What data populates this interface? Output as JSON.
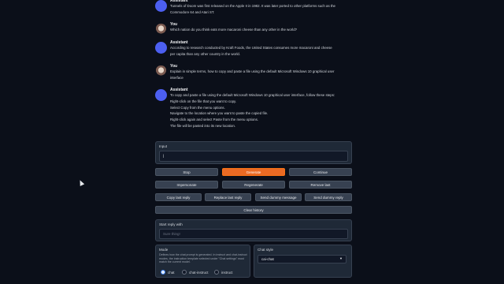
{
  "messages": [
    {
      "role": "assistant",
      "name": "Assistant",
      "lines": [
        "Tunnels of Doom was first released on the Apple II in 1982. It was later ported to other platforms such as the",
        "Commodore 64 and Atari ST."
      ]
    },
    {
      "role": "you",
      "name": "You",
      "lines": [
        "Which nation do you think eats more macaroni cheese than any other in the world?"
      ]
    },
    {
      "role": "assistant",
      "name": "Assistant",
      "lines": [
        "According to research conducted by Kraft Foods, the United States consumes more macaroni and cheese",
        "per capita than any other country in the world."
      ]
    },
    {
      "role": "you",
      "name": "You",
      "lines": [
        "Explain in simple terms, how to copy and paste a file using the default Microsoft Windows 10 graphical user",
        "interface"
      ]
    },
    {
      "role": "assistant",
      "name": "Assistant",
      "lines": [
        "To copy and paste a file using the default Microsoft Windows 10 graphical user interface, follow these steps:",
        "Right-click on the file that you want to copy.",
        "Select Copy from the menu options.",
        "Navigate to the location where you want to paste the copied file.",
        "Right-click again and select Paste from the menu options.",
        "The file will be pasted into its new location."
      ]
    }
  ],
  "input": {
    "label": "Input",
    "value": "|"
  },
  "buttons": {
    "stop": "Stop",
    "generate": "Generate",
    "continue": "Continue",
    "impersonate": "Impersonate",
    "regenerate": "Regenerate",
    "remove_last": "Remove last",
    "copy_last": "Copy last reply",
    "replace_last": "Replace last reply",
    "send_dummy_message": "Send dummy message",
    "send_dummy_reply": "Send dummy reply",
    "clear_history": "Clear history"
  },
  "start_reply": {
    "label": "Start reply with",
    "placeholder": "Sure thing!"
  },
  "mode": {
    "label": "Mode",
    "description": "Defines how the chat prompt is generated. In instruct and chat-instruct modes, the instruction template selected under \"Chat settings\" must match the current model.",
    "options": [
      "chat",
      "chat-instruct",
      "instruct"
    ],
    "selected": "chat"
  },
  "chat_style": {
    "label": "Chat style",
    "value": "cai-chat"
  }
}
